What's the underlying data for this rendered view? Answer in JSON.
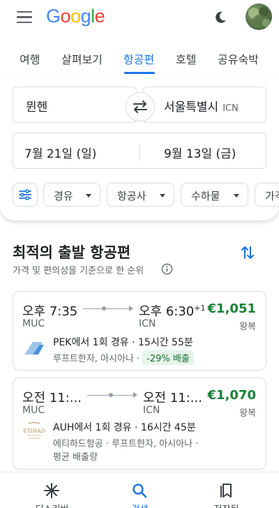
{
  "header": {
    "logo_letters": [
      "G",
      "o",
      "o",
      "g",
      "l",
      "e"
    ],
    "icons": {
      "menu": "menu-icon",
      "theme": "moon-icon",
      "avatar": "avatar"
    }
  },
  "tabs": [
    {
      "label": "여행"
    },
    {
      "label": "살펴보기"
    },
    {
      "label": "항공편"
    },
    {
      "label": "호텔"
    },
    {
      "label": "공유숙박"
    }
  ],
  "active_tab": "항공편",
  "search": {
    "origin": "뮌헨",
    "destination": "서울특별시",
    "destination_code": "ICN",
    "depart_date": "7월 21일 (일)",
    "return_date": "9월 13일 (금)"
  },
  "filters": [
    {
      "label": "경유"
    },
    {
      "label": "항공사"
    },
    {
      "label": "수하물"
    },
    {
      "label": "가격"
    }
  ],
  "results": {
    "title": "최적의 출발 항공편",
    "subtitle": "가격 및 편의성을 기준으로 한 순위"
  },
  "flights": [
    {
      "depart_time": "오후 7:35",
      "arrive_time": "오후 6:30",
      "day_offset": "+1",
      "from": "MUC",
      "to": "ICN",
      "price": "€1,051",
      "trip_type": "왕복",
      "stops": "PEK에서 1회 경유 · 15시간 55분",
      "airlines": "루프트한자, 아시아나 ·",
      "emissions": "-29% 배출"
    },
    {
      "depart_time": "오전 11:...",
      "arrive_time": "오전 11:...",
      "from": "MUC",
      "to": "ICN",
      "price": "€1,070",
      "trip_type": "왕복",
      "stops": "AUH에서 1회 경유 · 16시간 45분",
      "airlines": "에티하드항공 · 루프트한자, 아시아나 ·",
      "emissions": "평균 배출량",
      "airline_logo_text": "ETIHAD"
    }
  ],
  "bottom_nav": [
    {
      "label": "디스커버",
      "icon": "sparkle-icon"
    },
    {
      "label": "검색",
      "icon": "search-icon"
    },
    {
      "label": "저장됨",
      "icon": "bookmarks-icon"
    }
  ],
  "colors": {
    "accent": "#1a73e8",
    "price": "#188038",
    "emissions_bg": "#e6f4ea"
  }
}
